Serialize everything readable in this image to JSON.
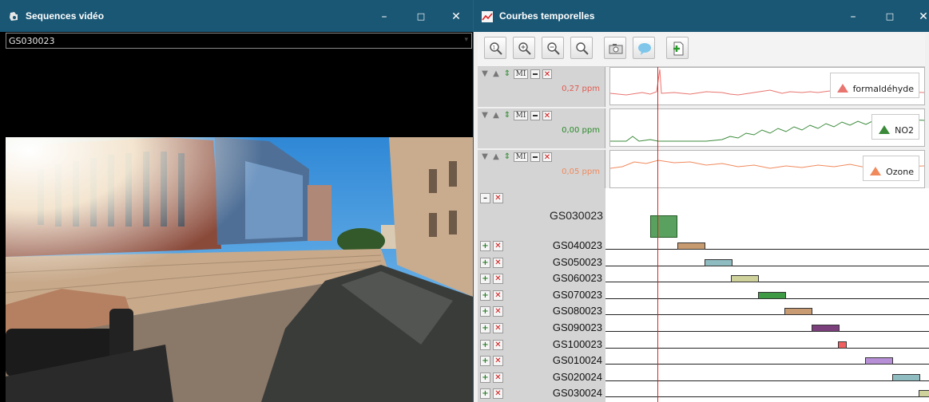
{
  "left_window": {
    "title": "Sequences vidéo",
    "selected_sequence": "GS030023",
    "buttons": {
      "minimize": "–",
      "maximize": "□",
      "close": "✕"
    }
  },
  "right_window": {
    "title": "Courbes temporelles",
    "buttons": {
      "minimize": "–",
      "maximize": "□",
      "close": "✕"
    },
    "toolbar": [
      "zoom-reset-icon",
      "zoom-in-icon",
      "zoom-out-icon",
      "search-icon",
      "screenshot-icon",
      "comment-icon",
      "export-icon"
    ],
    "tracks": [
      {
        "value": "0,27 ppm",
        "legend": "formaldéhyde",
        "color": "#e8756f"
      },
      {
        "value": "0,00 ppm",
        "legend": "NO2",
        "color": "#3a8a3a"
      },
      {
        "value": "0,05 ppm",
        "legend": "Ozone",
        "color": "#f08a5d"
      }
    ],
    "track_controls": {
      "mi": "MI"
    },
    "sequences": {
      "main": "GS030023",
      "rows": [
        {
          "name": "GS040023",
          "color": "#c89a70"
        },
        {
          "name": "GS050023",
          "color": "#8fbcc0"
        },
        {
          "name": "GS060023",
          "color": "#cfd39b"
        },
        {
          "name": "GS070023",
          "color": "#3f9a45"
        },
        {
          "name": "GS080023",
          "color": "#c99b72"
        },
        {
          "name": "GS090023",
          "color": "#7b3f7c"
        },
        {
          "name": "GS100023",
          "color": "#f06060"
        },
        {
          "name": "GS010024",
          "color": "#b78fd6"
        },
        {
          "name": "GS020024",
          "color": "#8fbcc0"
        },
        {
          "name": "GS030024",
          "color": "#cfd39b"
        }
      ]
    }
  }
}
